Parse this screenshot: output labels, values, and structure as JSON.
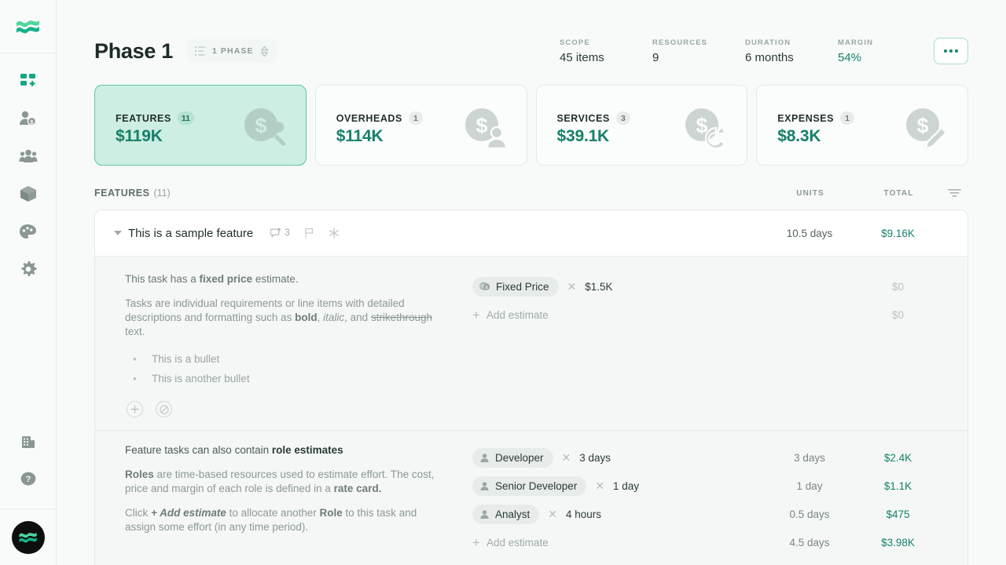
{
  "brand": {
    "accent": "#17806a",
    "accent_light": "#5ec5a5",
    "card_active_bg": "#cdeee2"
  },
  "sidebar": {
    "logo_name": "app-logo-waves",
    "items": [
      {
        "name": "dashboard-icon",
        "label": "Dashboard"
      },
      {
        "name": "client-billing-icon",
        "label": "Clients"
      },
      {
        "name": "team-icon",
        "label": "Team"
      },
      {
        "name": "products-icon",
        "label": "Products"
      },
      {
        "name": "branding-icon",
        "label": "Branding"
      },
      {
        "name": "settings-icon",
        "label": "Settings"
      }
    ],
    "bottom_items": [
      {
        "name": "company-icon",
        "label": "Company"
      },
      {
        "name": "help-icon",
        "label": "Help"
      }
    ],
    "avatar_name": "user-avatar-logo"
  },
  "header": {
    "title": "Phase 1",
    "phase_selector": {
      "label": "1 Phase",
      "icon": "list-icon",
      "stepper_icon": "chevron-updown-icon"
    },
    "metrics": [
      {
        "label": "Scope",
        "value": "45 items",
        "accent": false
      },
      {
        "label": "Resources",
        "value": "9",
        "accent": false
      },
      {
        "label": "Duration",
        "value": "6 months",
        "accent": false
      },
      {
        "label": "Margin",
        "value": "54%",
        "accent": true
      }
    ],
    "more_button_label": "•••"
  },
  "cards": [
    {
      "name": "Features",
      "count": "11",
      "value": "$119K",
      "icon": "coin-wrench-icon",
      "active": true
    },
    {
      "name": "Overheads",
      "count": "1",
      "value": "$114K",
      "icon": "coin-person-icon",
      "active": false
    },
    {
      "name": "Services",
      "count": "3",
      "value": "$39.1K",
      "icon": "coin-refresh-icon",
      "active": false
    },
    {
      "name": "Expenses",
      "count": "1",
      "value": "$8.3K",
      "icon": "coin-pencil-icon",
      "active": false
    }
  ],
  "table": {
    "section_title": "Features",
    "section_count": "(11)",
    "col_units": "Units",
    "col_total": "Total",
    "filter_icon": "filter-icon"
  },
  "feature": {
    "name": "This is a sample feature",
    "comments_icon": "comment-icon",
    "comments_count": "3",
    "flag_icon": "flag-icon",
    "sparkle_icon": "sparkle-icon",
    "units": "10.5 days",
    "total": "$9.16K"
  },
  "tasks": [
    {
      "paragraphs": [
        {
          "parts": [
            {
              "t": "This task has a ",
              "s": "n"
            },
            {
              "t": "fixed price",
              "s": "b"
            },
            {
              "t": " estimate.",
              "s": "n"
            }
          ]
        },
        {
          "parts": [
            {
              "t": "Tasks are individual requirements or line items with detailed descriptions and formatting such as ",
              "s": "n"
            },
            {
              "t": "bold",
              "s": "b"
            },
            {
              "t": ", ",
              "s": "n"
            },
            {
              "t": "italic",
              "s": "i"
            },
            {
              "t": ", and ",
              "s": "n"
            },
            {
              "t": "strikethrough",
              "s": "s"
            },
            {
              "t": " text.",
              "s": "n"
            }
          ]
        }
      ],
      "bullets": [
        "This is a bullet",
        "This is another bullet"
      ],
      "actions": [
        {
          "name": "add-task-button",
          "glyph": "+"
        },
        {
          "name": "block-task-button",
          "glyph": "⊘"
        }
      ],
      "estimates": [
        {
          "chip": "Fixed Price",
          "chip_icon": "coins-stack-icon",
          "amount": "$1.5K",
          "units": "",
          "total": "$0",
          "total_muted": true
        }
      ],
      "add_estimate_label": "Add estimate",
      "add_estimate_units": "",
      "add_estimate_total": "$0",
      "add_estimate_total_muted": true
    },
    {
      "paragraphs": [
        {
          "parts": [
            {
              "t": "Feature tasks can also contain ",
              "s": "n"
            },
            {
              "t": "role estimates",
              "s": "b"
            }
          ]
        },
        {
          "parts": [
            {
              "t": "Roles",
              "s": "b"
            },
            {
              "t": " are time-based resources used to estimate effort. The cost, price and margin of each role is defined in a ",
              "s": "n"
            },
            {
              "t": "rate card.",
              "s": "b"
            }
          ]
        },
        {
          "parts": [
            {
              "t": "Click ",
              "s": "n"
            },
            {
              "t": "+ Add estimate",
              "s": "bi"
            },
            {
              "t": " to allocate another ",
              "s": "n"
            },
            {
              "t": "Role",
              "s": "b"
            },
            {
              "t": " to this task and assign some effort (in any time period).",
              "s": "n"
            }
          ]
        }
      ],
      "bullets": [],
      "actions": [],
      "estimates": [
        {
          "chip": "Developer",
          "chip_icon": "person-icon",
          "amount": "3 days",
          "units": "3 days",
          "total": "$2.4K",
          "total_muted": false
        },
        {
          "chip": "Senior Developer",
          "chip_icon": "person-icon",
          "amount": "1 day",
          "units": "1 day",
          "total": "$1.1K",
          "total_muted": false
        },
        {
          "chip": "Analyst",
          "chip_icon": "person-icon",
          "amount": "4 hours",
          "units": "0.5 days",
          "total": "$475",
          "total_muted": false
        }
      ],
      "add_estimate_label": "Add estimate",
      "add_estimate_units": "4.5 days",
      "add_estimate_total": "$3.98K",
      "add_estimate_total_muted": false
    }
  ]
}
